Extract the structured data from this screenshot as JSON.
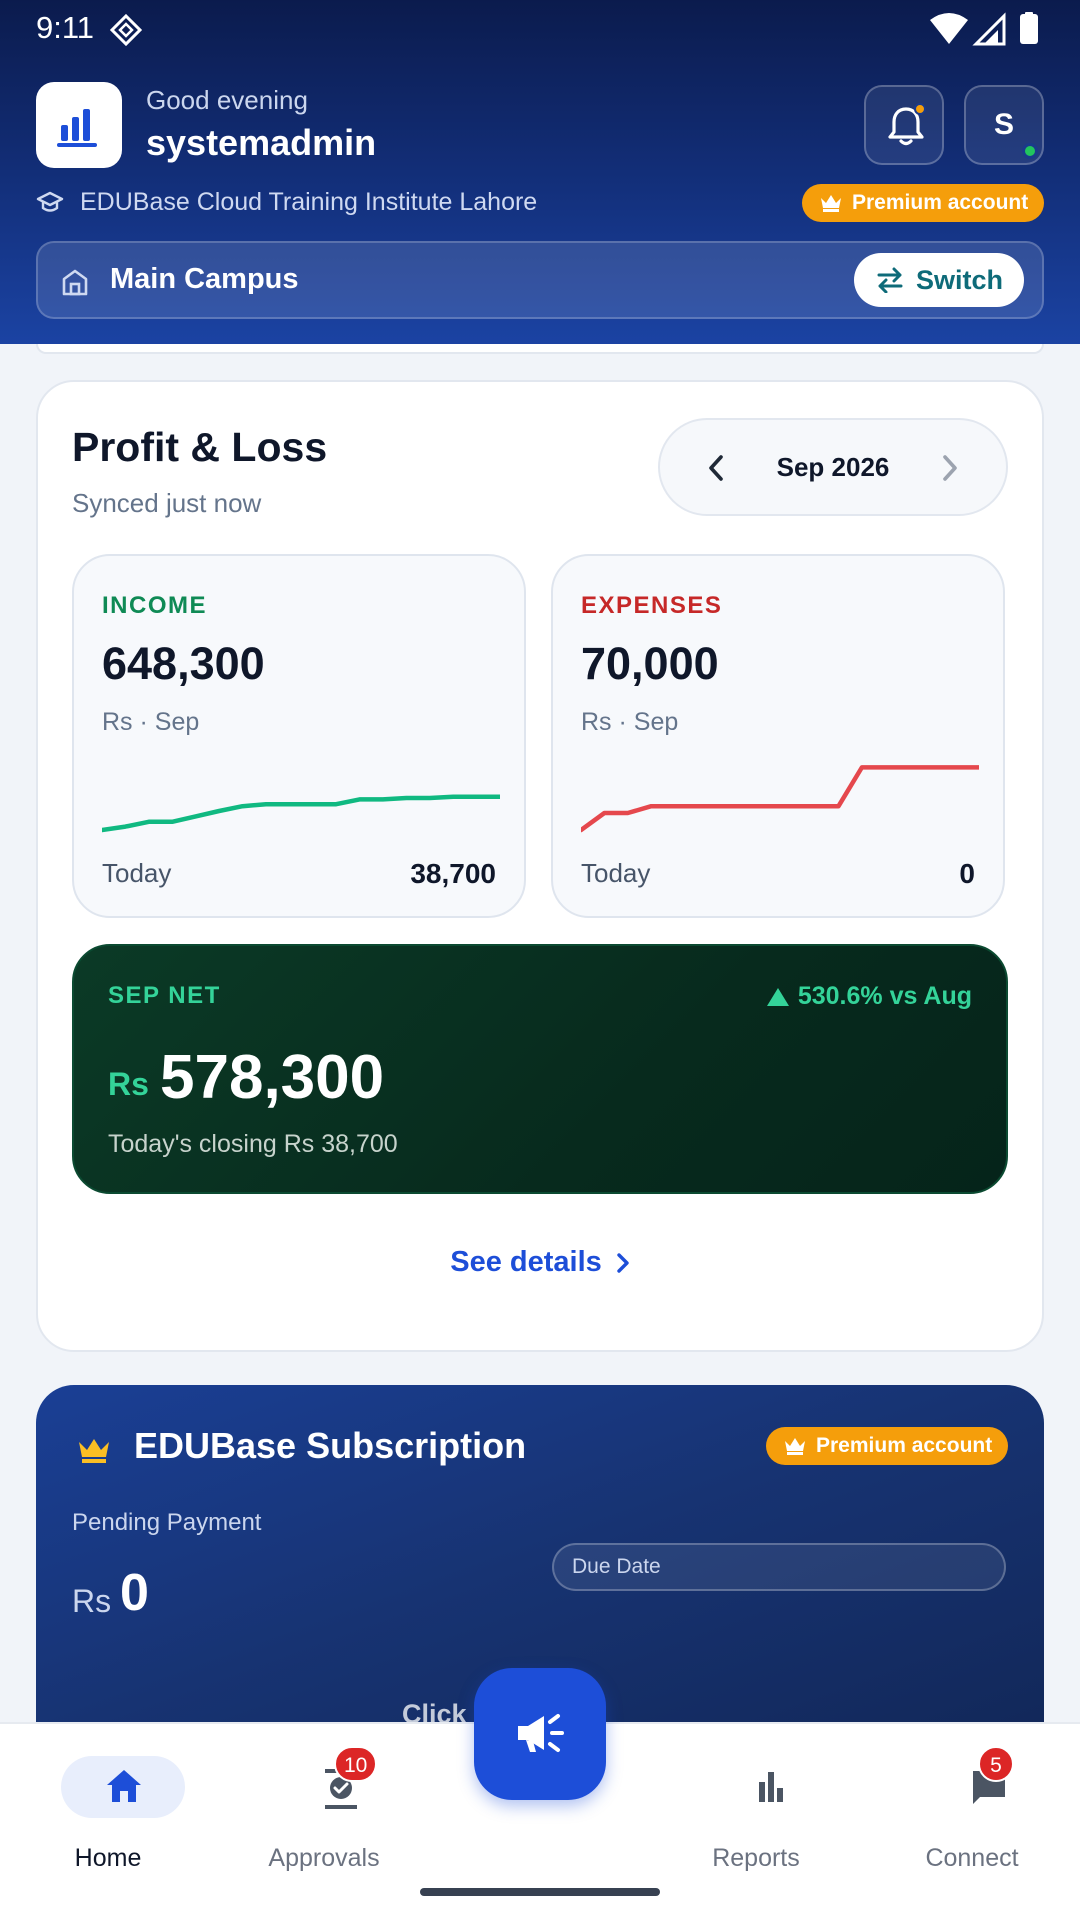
{
  "status_bar": {
    "time": "9:11"
  },
  "header": {
    "greeting": "Good evening",
    "username": "systemadmin",
    "avatar_initial": "S",
    "institute": "EDUBase Cloud Training Institute Lahore",
    "premium_label": "Premium account",
    "campus": "Main Campus",
    "switch_label": "Switch"
  },
  "profit_loss": {
    "title": "Profit & Loss",
    "synced": "Synced just now",
    "month": "Sep 2026",
    "income": {
      "label": "INCOME",
      "amount": "648,300",
      "unit": "Rs · Sep",
      "today_label": "Today",
      "today_value": "38,700",
      "trend": [
        0.0,
        0.05,
        0.12,
        0.12,
        0.2,
        0.28,
        0.35,
        0.38,
        0.38,
        0.38,
        0.38,
        0.45,
        0.45,
        0.47,
        0.47,
        0.49,
        0.49,
        0.49
      ]
    },
    "expenses": {
      "label": "EXPENSES",
      "amount": "70,000",
      "unit": "Rs · Sep",
      "today_label": "Today",
      "today_value": "0",
      "trend": [
        0.0,
        0.25,
        0.25,
        0.35,
        0.35,
        0.35,
        0.35,
        0.35,
        0.35,
        0.35,
        0.35,
        0.35,
        0.92,
        0.92,
        0.92,
        0.92,
        0.92,
        0.92
      ]
    },
    "net": {
      "label": "SEP NET",
      "change": "530.6% vs Aug",
      "currency": "Rs",
      "value": "578,300",
      "closing": "Today's closing Rs 38,700"
    },
    "see_details": "See details"
  },
  "subscription": {
    "title": "EDUBase Subscription",
    "premium_label": "Premium account",
    "pending_label": "Pending Payment",
    "currency": "Rs",
    "pending_value": "0",
    "due_date_label": "Due Date",
    "link_text": "Click to ... ails"
  },
  "bottom_nav": {
    "items": [
      {
        "label": "Home",
        "icon": "home-icon",
        "badge": ""
      },
      {
        "label": "Approvals",
        "icon": "approvals-icon",
        "badge": "10"
      },
      {
        "label": "Reports",
        "icon": "bar-chart-icon",
        "badge": ""
      },
      {
        "label": "Connect",
        "icon": "chat-icon",
        "badge": "5"
      }
    ]
  },
  "colors": {
    "header_dark": "#0b1b4d",
    "accent_blue": "#1d4ed8",
    "income_green": "#10b981",
    "expense_red": "#e5484d",
    "premium_orange": "#f59e0b",
    "net_green": "#34d399"
  }
}
